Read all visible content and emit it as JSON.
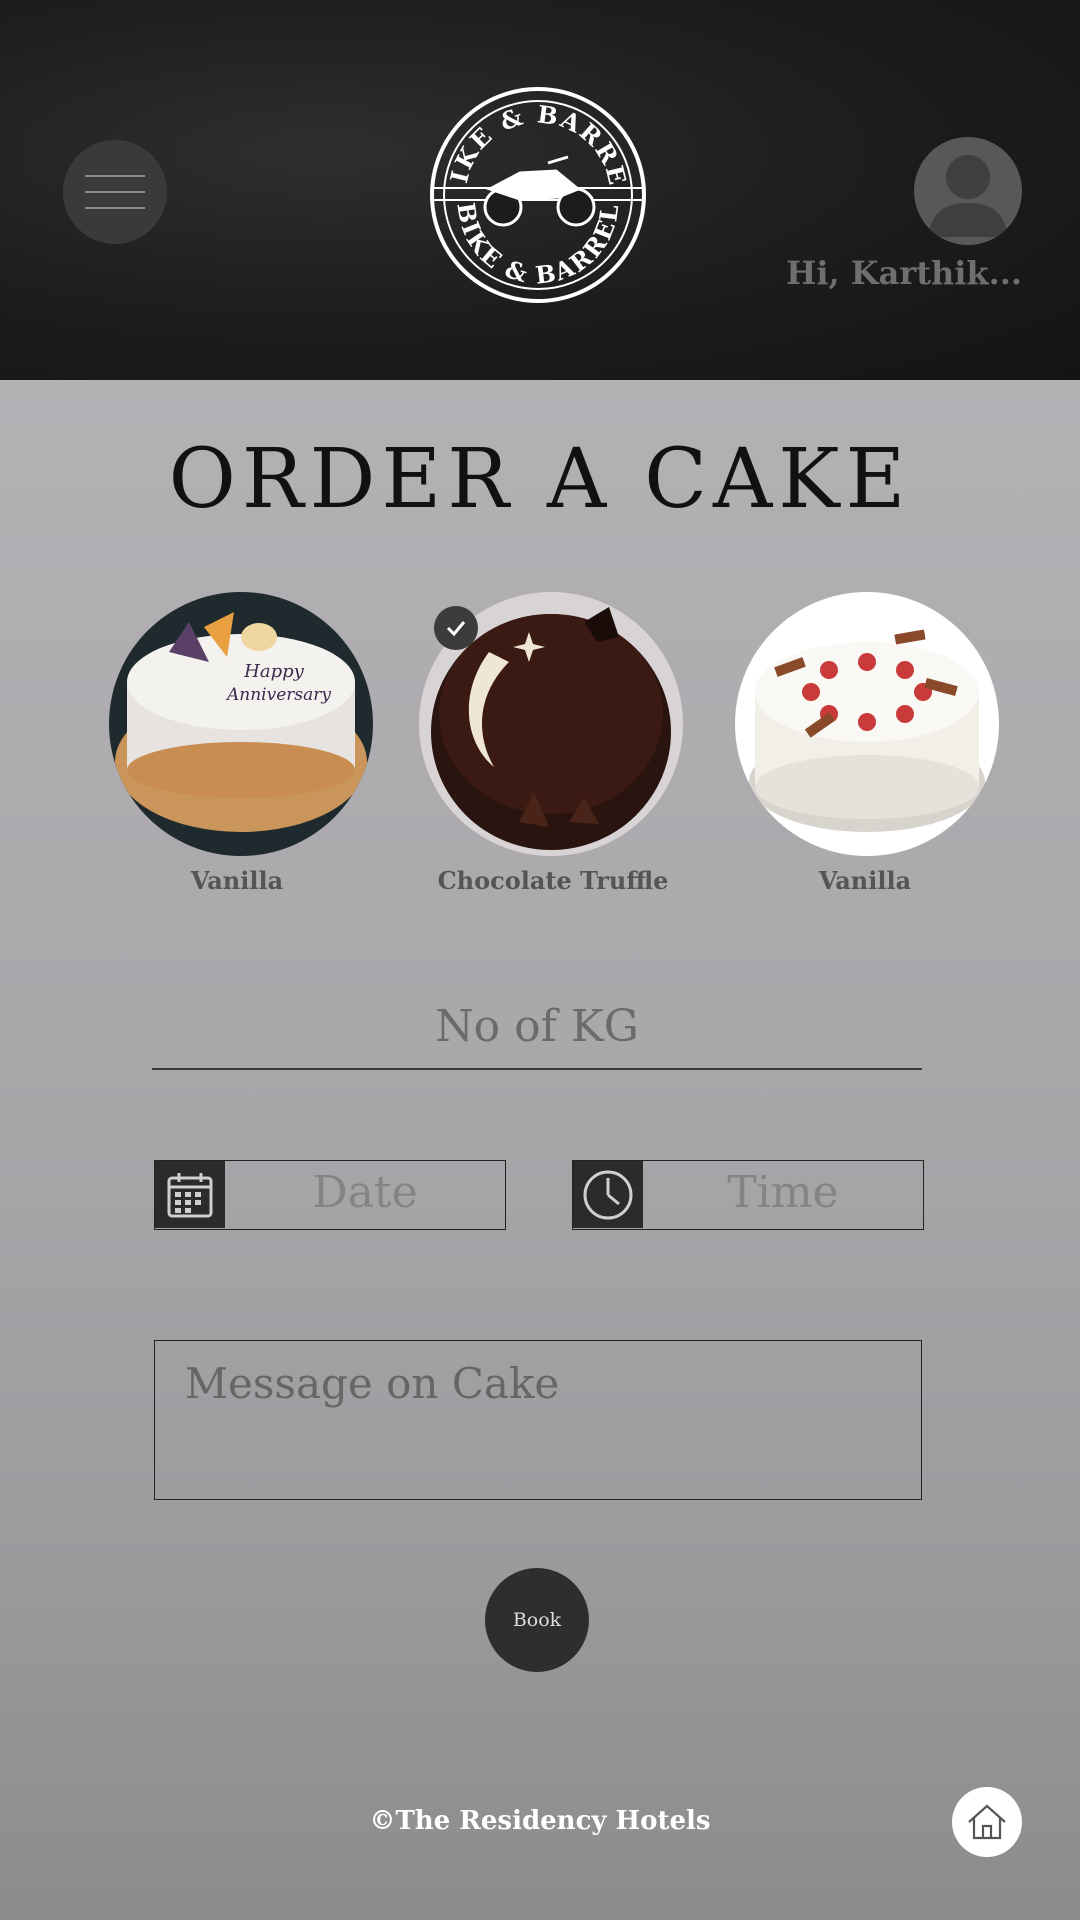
{
  "header": {
    "logo_text_top": "BIKE & BARREL",
    "logo_text_bottom": "BIKE & BARREL",
    "greeting": "Hi, Karthik..."
  },
  "page": {
    "title": "ORDER A CAKE"
  },
  "cakes": [
    {
      "label": "Vanilla",
      "selected": false
    },
    {
      "label": "Chocolate Truffle",
      "selected": true
    },
    {
      "label": "Vanilla",
      "selected": false
    }
  ],
  "cake_decoration": {
    "line1": "Happy",
    "line2": "Anniversary"
  },
  "form": {
    "kg_placeholder": "No of KG",
    "date_placeholder": "Date",
    "time_placeholder": "Time",
    "message_placeholder": "Message on Cake",
    "book_label": "Book"
  },
  "footer": {
    "copyright": "©The Residency Hotels"
  },
  "icons": {
    "menu": "menu-icon",
    "avatar": "user-avatar-icon",
    "check": "check-icon",
    "calendar": "calendar-icon",
    "clock": "clock-icon",
    "home": "home-icon"
  },
  "colors": {
    "header_bg": "#1c1c1c",
    "content_bg": "#a9a7a9",
    "button_dark": "#2e2e2e",
    "title_text": "#111111"
  }
}
